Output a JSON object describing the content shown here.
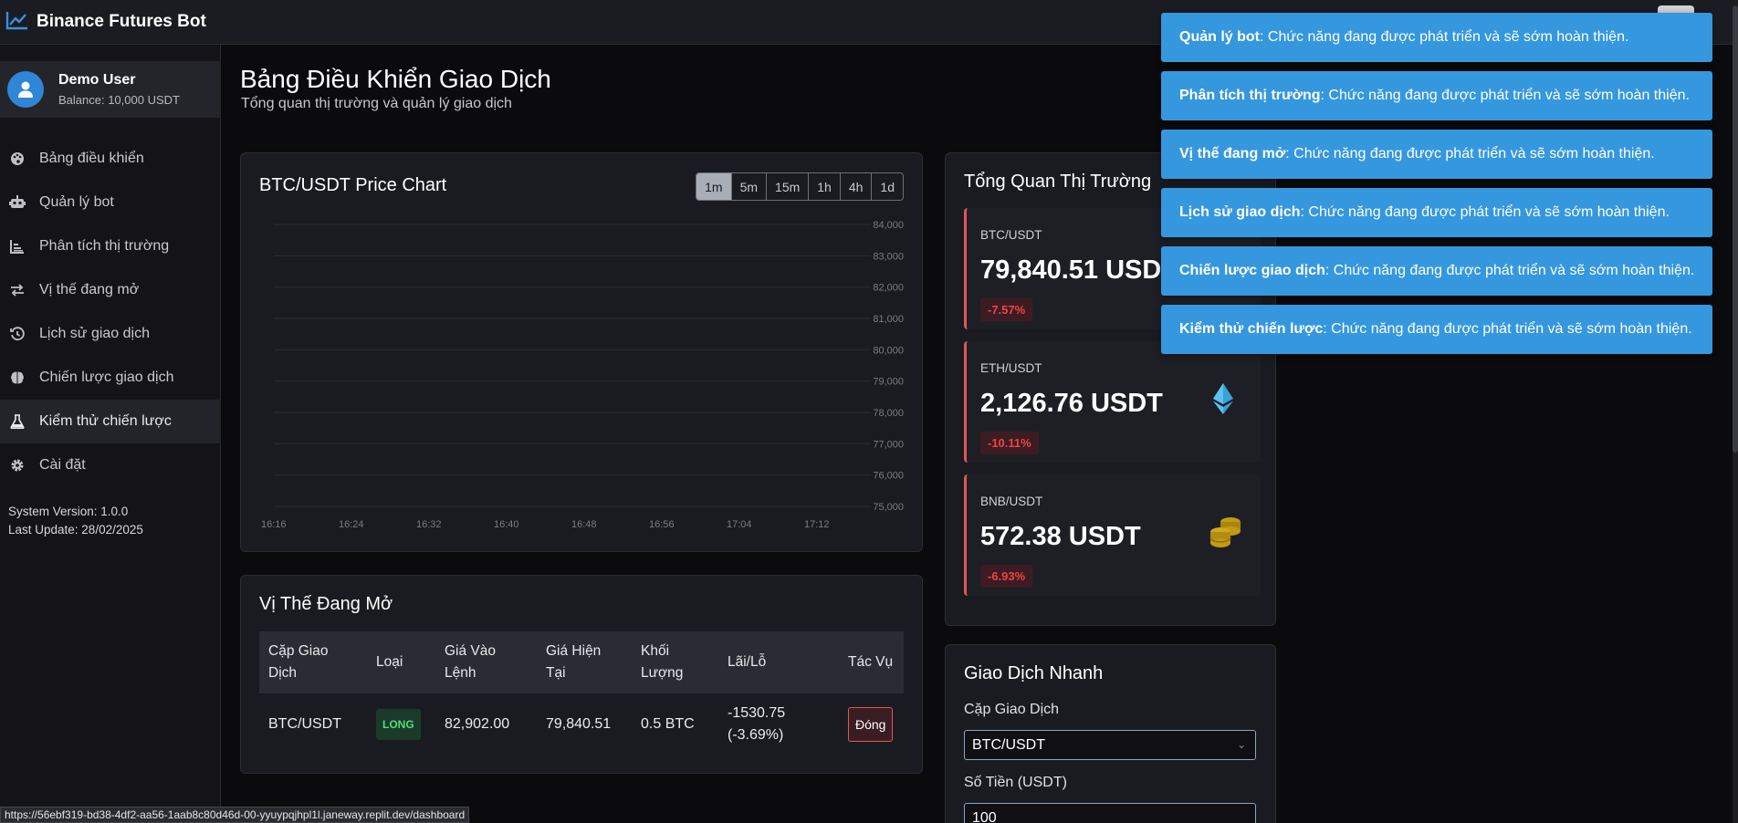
{
  "app": {
    "title": "Binance Futures Bot"
  },
  "user": {
    "name": "Demo User",
    "balance": "Balance: 10,000 USDT"
  },
  "sidebar": {
    "items": [
      {
        "label": "Bảng điều khiển",
        "icon": "palette-icon"
      },
      {
        "label": "Quản lý bot",
        "icon": "robot-icon"
      },
      {
        "label": "Phân tích thị trường",
        "icon": "chart-bar-icon"
      },
      {
        "label": "Vị thế đang mở",
        "icon": "exchange-icon"
      },
      {
        "label": "Lịch sử giao dịch",
        "icon": "history-icon"
      },
      {
        "label": "Chiến lược giao dịch",
        "icon": "brain-icon"
      },
      {
        "label": "Kiểm thử chiến lược",
        "icon": "flask-icon"
      },
      {
        "label": "Cài đặt",
        "icon": "gear-icon"
      }
    ],
    "active_index": 6,
    "system_version": "System Version: 1.0.0",
    "last_update": "Last Update: 28/02/2025"
  },
  "main": {
    "title": "Bảng Điều Khiển Giao Dịch",
    "subtitle": "Tổng quan thị trường và quản lý giao dịch"
  },
  "price_chart": {
    "title": "BTC/USDT Price Chart",
    "timeframes": [
      "1m",
      "5m",
      "15m",
      "1h",
      "4h",
      "1d"
    ],
    "active_timeframe": "1m"
  },
  "chart_data": {
    "type": "line",
    "title": "BTC/USDT Price Chart",
    "x": [
      "16:16",
      "16:24",
      "16:32",
      "16:40",
      "16:48",
      "16:56",
      "17:04",
      "17:12"
    ],
    "y_ticks": [
      "84,000",
      "83,000",
      "82,000",
      "81,000",
      "80,000",
      "79,000",
      "78,000",
      "77,000",
      "76,000",
      "75,000"
    ],
    "ylim": [
      75000,
      84000
    ],
    "series": [],
    "grid": true,
    "xlabel": "",
    "ylabel": ""
  },
  "positions": {
    "title": "Vị Thế Đang Mở",
    "headers": [
      "Cặp Giao Dịch",
      "Loại",
      "Giá Vào Lệnh",
      "Giá Hiện Tại",
      "Khối Lượng",
      "Lãi/Lỗ",
      "Tác Vụ"
    ],
    "rows": [
      {
        "pair": "BTC/USDT",
        "type": "LONG",
        "entry": "82,902.00",
        "current": "79,840.51",
        "volume": "0.5 BTC",
        "pnl": "-1530.75 (-3.69%)",
        "action": "Đóng"
      }
    ]
  },
  "market": {
    "title": "Tổng Quan Thị Trường",
    "items": [
      {
        "symbol": "BTC/USDT",
        "price": "79,840.51 USD",
        "change": "-7.57%",
        "icon": "bitcoin-icon"
      },
      {
        "symbol": "ETH/USDT",
        "price": "2,126.76 USDT",
        "change": "-10.11%",
        "icon": "ethereum-icon"
      },
      {
        "symbol": "BNB/USDT",
        "price": "572.38 USDT",
        "change": "-6.93%",
        "icon": "coins-icon"
      }
    ]
  },
  "quick_trade": {
    "title": "Giao Dịch Nhanh",
    "pair_label": "Cặp Giao Dịch",
    "pair_value": "BTC/USDT",
    "amount_label": "Số Tiền (USDT)",
    "amount_value": "100"
  },
  "toasts": [
    {
      "bold": "Quản lý bot",
      "text": ": Chức năng đang được phát triển và sẽ sớm hoàn thiện."
    },
    {
      "bold": "Phân tích thị trường",
      "text": ": Chức năng đang được phát triển và sẽ sớm hoàn thiện."
    },
    {
      "bold": "Vị thế đang mở",
      "text": ": Chức năng đang được phát triển và sẽ sớm hoàn thiện."
    },
    {
      "bold": "Lịch sử giao dịch",
      "text": ": Chức năng đang được phát triển và sẽ sớm hoàn thiện."
    },
    {
      "bold": "Chiến lược giao dịch",
      "text": ": Chức năng đang được phát triển và sẽ sớm hoàn thiện."
    },
    {
      "bold": "Kiểm thử chiến lược",
      "text": ": Chức năng đang được phát triển và sẽ sớm hoàn thiện."
    }
  ],
  "status_url": "https://56ebf319-bd38-4df2-aa56-1aab8c80d46d-00-yyuypqjhpl1l.janeway.replit.dev/dashboard",
  "colors": {
    "accent": "#3597de",
    "negative": "#ef4444",
    "positive": "#4ade80",
    "background": "#0b0b0e",
    "card": "#1a1b20"
  }
}
